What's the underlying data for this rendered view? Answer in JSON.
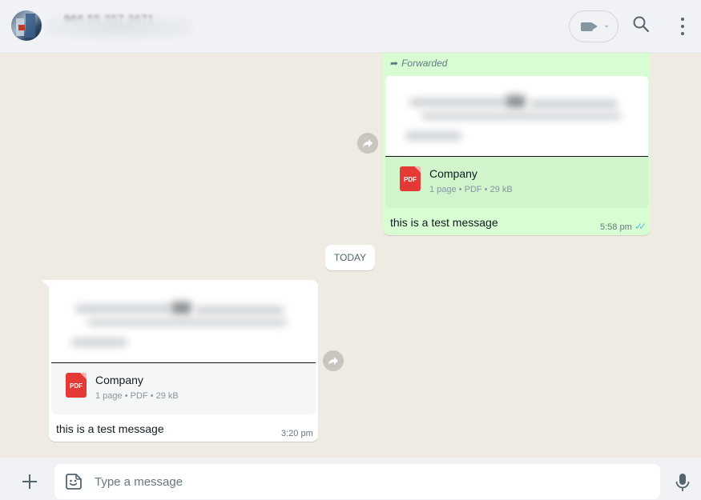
{
  "header": {
    "contact_name": "966 55 357 3671",
    "icons": {
      "video": "video-call-icon",
      "search": "search-icon",
      "menu": "more-vertical-icon"
    }
  },
  "chat": {
    "messages": [
      {
        "direction": "outgoing",
        "forwarded_label": "Forwarded",
        "document": {
          "name": "Company",
          "meta": "1 page • PDF • 29 kB",
          "icon_text": "PDF"
        },
        "text": "this is a test message",
        "time": "5:58 pm",
        "status": "read"
      },
      {
        "direction": "incoming",
        "document": {
          "name": "Company",
          "meta": "1 page • PDF • 29 kB",
          "icon_text": "PDF"
        },
        "text": "this is a test message",
        "time": "3:20 pm"
      }
    ],
    "date_divider": "TODAY"
  },
  "composer": {
    "placeholder": "Type a message",
    "value": ""
  },
  "colors": {
    "outgoing_bubble": "#d9fdd3",
    "incoming_bubble": "#ffffff",
    "chat_background": "#efeae2",
    "read_ticks": "#53bdeb",
    "pdf_red": "#e53935"
  }
}
